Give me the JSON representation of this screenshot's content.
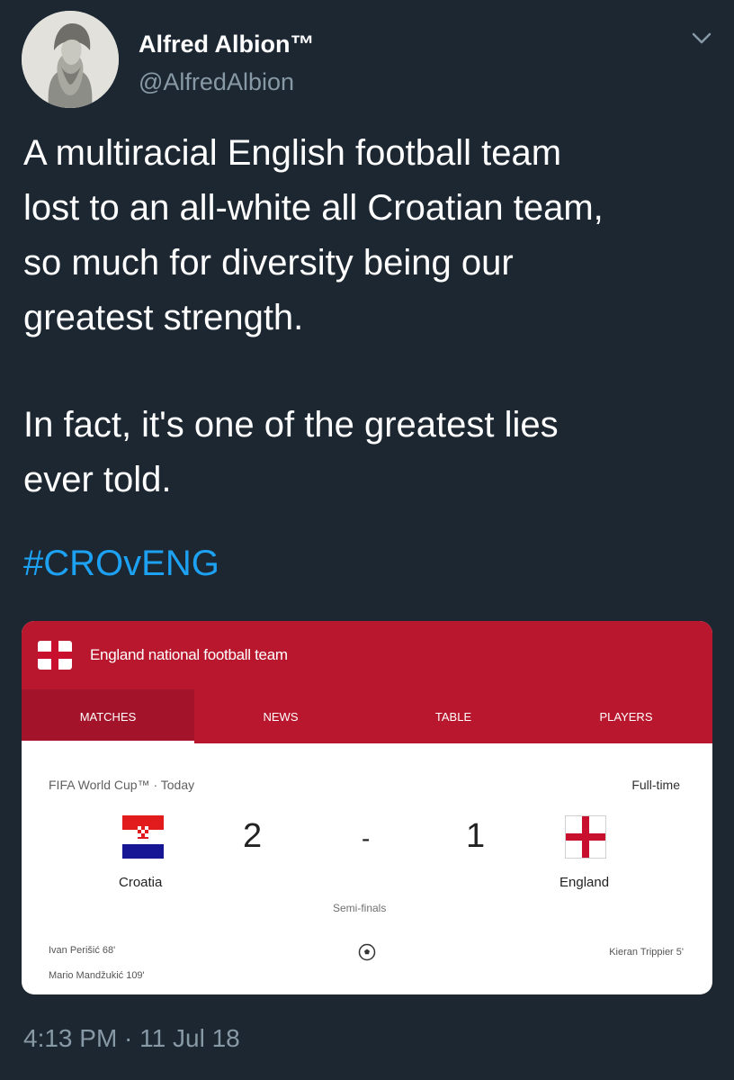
{
  "user": {
    "name": "Alfred Albion™",
    "handle": "@AlfredAlbion"
  },
  "tweet": {
    "paragraph_1": "A multiracial English football team\nlost to an all-white all Croatian team,\nso much for diversity being our\ngreatest strength.",
    "paragraph_2": "In fact, it's one of the greatest lies\never told.",
    "hashtag": "#CROvENG",
    "timestamp": "4:13 PM · 11 Jul 18"
  },
  "card": {
    "title": "England national football team",
    "tabs": [
      {
        "label": "MATCHES",
        "active": true
      },
      {
        "label": "NEWS",
        "active": false
      },
      {
        "label": "TABLE",
        "active": false
      },
      {
        "label": "PLAYERS",
        "active": false
      }
    ],
    "competition": "FIFA World Cup™ · Today",
    "status": "Full-time",
    "home_team": "Croatia",
    "away_team": "England",
    "home_score": "2",
    "away_score": "1",
    "score_separator": "-",
    "stage": "Semi-finals",
    "home_scorers": [
      "Ivan Perišić 68'",
      "Mario Mandžukić 109'"
    ],
    "away_scorers": [
      "Kieran Trippier 5'"
    ]
  },
  "colors": {
    "background": "#1c2732",
    "hashtag": "#1da1f2",
    "card_header": "#b8172d",
    "muted_text": "#8899a6"
  },
  "icons": [
    "chevron-down-icon",
    "england-flag-icon",
    "croatia-flag-icon",
    "football-icon"
  ]
}
